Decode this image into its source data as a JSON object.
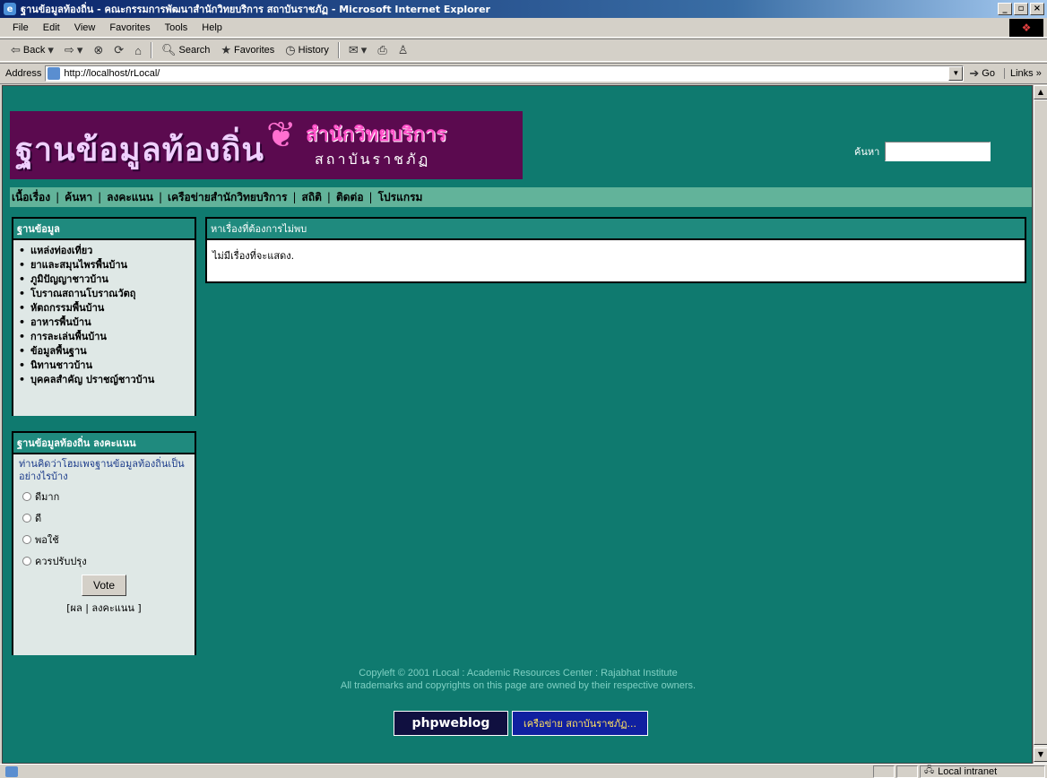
{
  "window": {
    "title": "ฐานข้อมูลท้องถิ่น - คณะกรรมการพัฒนาสำนักวิทยบริการ สถาบันราชภัฏ - Microsoft Internet Explorer",
    "min": "_",
    "max": "▫",
    "close": "×"
  },
  "menu": [
    "File",
    "Edit",
    "View",
    "Favorites",
    "Tools",
    "Help"
  ],
  "toolbar": {
    "back": "Back",
    "search": "Search",
    "favorites": "Favorites",
    "history": "History"
  },
  "address": {
    "label": "Address",
    "url": "http://localhost/rLocal/",
    "go": "Go",
    "links": "Links »"
  },
  "banner": {
    "logo_main": "ฐานข้อมูลท้องถิ่น",
    "logo_side": "สำนักวิทยบริการ",
    "logo_sub": "สถาบันราชภัฏ"
  },
  "search": {
    "label": "ค้นหา"
  },
  "nav": [
    "เนื้อเรื่อง",
    "ค้นหา",
    "ลงคะแนน",
    "เครือข่ายสำนักวิทยบริการ",
    "สถิติ",
    "ติดต่อ",
    "โปรแกรม"
  ],
  "panel1": {
    "title": "ฐานข้อมูล",
    "items": [
      "แหล่งท่องเที่ยว",
      "ยาและสมุนไพรพื้นบ้าน",
      "ภูมิปัญญาชาวบ้าน",
      "โบราณสถานโบราณวัตถุ",
      "หัตถกรรมพื้นบ้าน",
      "อาหารพื้นบ้าน",
      "การละเล่นพื้นบ้าน",
      "ข้อมูลพื้นฐาน",
      "นิทานชาวบ้าน",
      "บุคคลสำคัญ ปราชญ์ชาวบ้าน"
    ]
  },
  "poll": {
    "title": "ฐานข้อมูลท้องถิ่น ลงคะแนน",
    "question": "ท่านคิดว่าโฮมเพจฐานข้อมูลท้องถิ่นเป็นอย่างไรบ้าง",
    "options": [
      "ดีมาก",
      "ดี",
      "พอใช้",
      "ควรปรับปรุง"
    ],
    "vote": "Vote",
    "links": "[ผล | ลงคะแนน ]"
  },
  "main": {
    "header": "หาเรื่องที่ต้องการไม่พบ",
    "message": "ไม่มีเรื่องที่จะแสดง."
  },
  "footer": {
    "line1": "Copyleft © 2001 rLocal : Academic Resources Center : Rajabhat Institute",
    "line2": "All trademarks and copyrights on this page are owned by their respective owners.",
    "badge1": "phpweblog",
    "badge2": "เครือข่าย สถาบันราชภัฏ..."
  },
  "status": {
    "zone": "Local intranet"
  },
  "colors": {
    "page_bg": "#0f7a6f",
    "nav_bg": "#62b39a",
    "panel_head": "#1f8a7e",
    "banner_bg": "#5b0a4f"
  }
}
